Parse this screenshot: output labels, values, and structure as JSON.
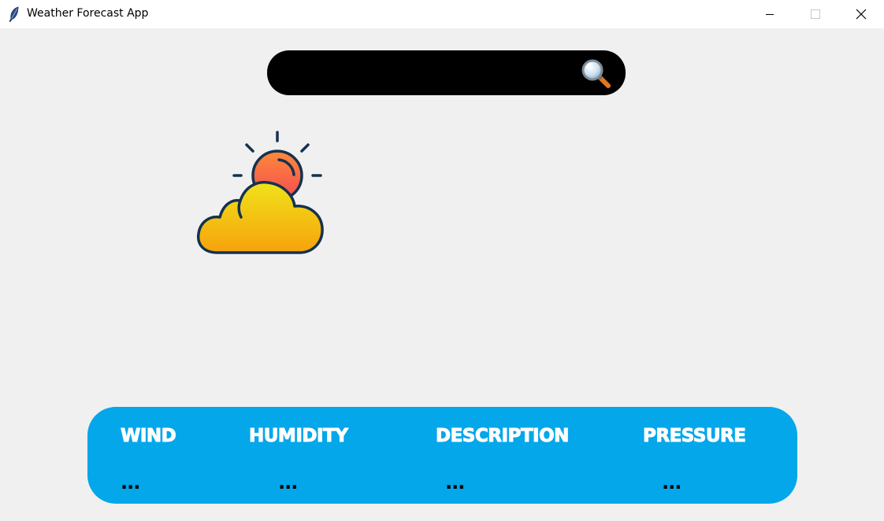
{
  "window": {
    "title": "Weather Forecast App",
    "controls": {
      "minimize_icon": "minimize-icon",
      "maximize_icon": "maximize-icon",
      "close_icon": "close-icon"
    }
  },
  "search": {
    "value": "",
    "placeholder": "",
    "icon": "search-icon",
    "bar_color": "#000000"
  },
  "weather_logo": {
    "icon": "sun-cloud-icon"
  },
  "info_panel": {
    "color": "#03a7ea",
    "items": [
      {
        "label": "WIND",
        "value": "..."
      },
      {
        "label": "HUMIDITY",
        "value": "..."
      },
      {
        "label": "DESCRIPTION",
        "value": "..."
      },
      {
        "label": "PRESSURE",
        "value": "..."
      }
    ]
  }
}
